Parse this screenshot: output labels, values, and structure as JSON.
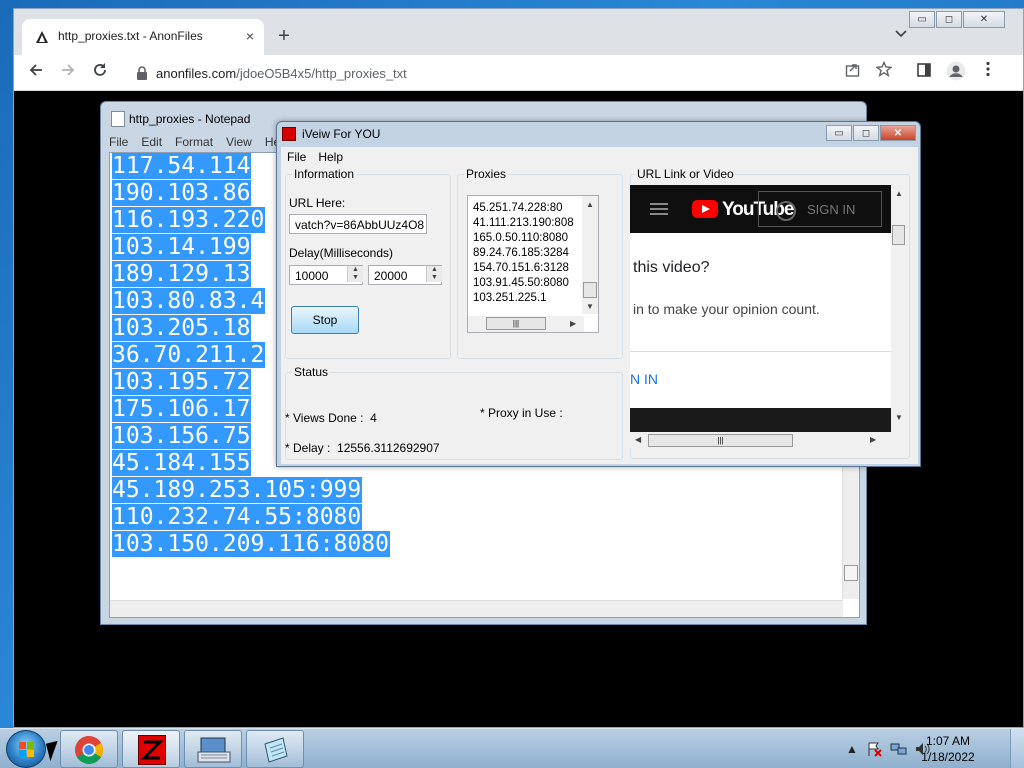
{
  "browser": {
    "tab_title": "http_proxies.txt - AnonFiles",
    "tab_close": "×",
    "new_tab": "+",
    "url_host": "anonfiles.com",
    "url_path": "/jdoeO5B4x5/http_proxies_txt",
    "window_buttons": {
      "minimize": "▭",
      "restore": "◻",
      "close": "✕"
    }
  },
  "notepad": {
    "title": "http_proxies - Notepad",
    "menu": [
      "File",
      "Edit",
      "Format",
      "View",
      "Help"
    ],
    "lines": [
      "117.54.114",
      "190.103.86",
      "116.193.220",
      "103.14.199",
      "189.129.13",
      "103.80.83.4",
      "103.205.18",
      "36.70.211.2",
      "103.195.72",
      "175.106.17",
      "103.156.75",
      "45.184.155",
      "45.189.253.105:999",
      "110.232.74.55:8080",
      "103.150.209.116:8080"
    ]
  },
  "iview": {
    "title": "iVeiw For YOU",
    "menu": [
      "File",
      "Help"
    ],
    "information": {
      "label": "Information",
      "url_label": "URL Here:",
      "url_value": "vatch?v=86AbbUUz4O8",
      "delay_label": "Delay(Milliseconds)",
      "delay_min": "10000",
      "delay_max": "20000",
      "stop_button": "Stop"
    },
    "proxies": {
      "label": "Proxies",
      "items": [
        "45.251.74.228:80",
        "41.111.213.190:808",
        "165.0.50.110:8080",
        "89.24.76.185:3284",
        "154.70.151.6:3128",
        "103.91.45.50:8080",
        "103.251.225.1"
      ]
    },
    "url_view": {
      "label": "URL Link or Video",
      "yt_logo_text": "YouTube",
      "sign_in": "SIGN IN",
      "heading": "this video?",
      "subtext": "in to make your opinion count.",
      "link": "N IN"
    },
    "status": {
      "label": "Status",
      "views_done_label": "* Views Done :",
      "views_done": "4",
      "proxy_in_use_label": "* Proxy in Use :",
      "delay_label": "* Delay :",
      "delay_value": "12556.3112692907"
    }
  },
  "taskbar": {
    "time": "1:07 AM",
    "date": "1/18/2022",
    "tray_icons": [
      "show-hidden-icon",
      "action-center-flag-icon",
      "network-icon",
      "volume-icon"
    ]
  },
  "colors": {
    "selection": "#3399ff",
    "tab_strip": "#dee1e6",
    "close_red": "#c9452c",
    "youtube_red": "#ff0000"
  }
}
